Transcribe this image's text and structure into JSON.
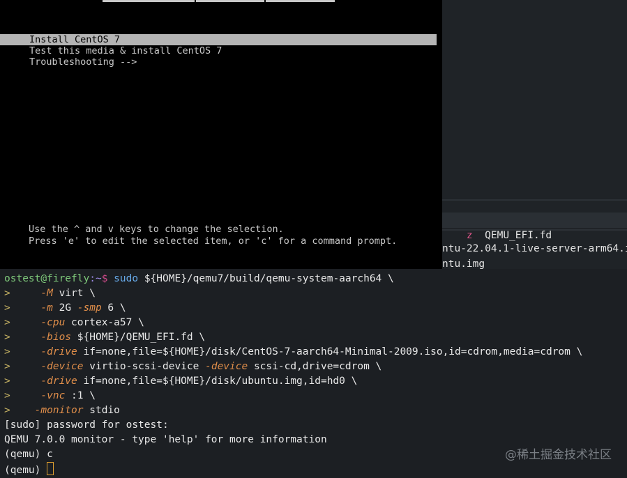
{
  "vnc": {
    "menu": [
      {
        "label": "Install CentOS 7",
        "selected": true
      },
      {
        "label": "Test this media & install CentOS 7",
        "selected": false
      },
      {
        "label": "Troubleshooting -->",
        "selected": false
      }
    ],
    "help_line1": "Use the ^ and v keys to change the selection.",
    "help_line2": "Press 'e' to edit the selected item, or 'c' for a command prompt."
  },
  "background_terminal": {
    "items": [
      {
        "marker": "z",
        "name": "QEMU_EFI.fd"
      },
      {
        "marker": "",
        "name": "ntu-22.04.1-live-server-arm64.i"
      },
      {
        "marker": "",
        "name": "ntu.img"
      }
    ]
  },
  "terminal": {
    "user_host": "ostest@firefly",
    "path": ":~",
    "dollar": "$",
    "cmd_sudo": "sudo",
    "cmd_binary_prefix": "${",
    "cmd_home": "HOME",
    "cmd_binary_rest": "}/qemu7/build/qemu-system-aarch64 \\",
    "continuation": ">",
    "args": [
      {
        "opt": "-M",
        "value": " virt \\"
      },
      {
        "opt": "-m",
        "value": " 2G ",
        "opt2": "-smp",
        "value2": " 6 \\"
      },
      {
        "opt": "-cpu",
        "value": " cortex-a57 \\"
      },
      {
        "opt": "-bios",
        "value": " ${HOME}/QEMU_EFI.fd \\"
      },
      {
        "opt": "-drive",
        "value": " if=none,file=${HOME}/disk/CentOS-7-aarch64-Minimal-2009.iso,id=cdrom,media=cdrom \\"
      },
      {
        "opt": "-device",
        "value": " virtio-scsi-device ",
        "opt2": "-device",
        "value2": " scsi-cd,drive=cdrom \\"
      },
      {
        "opt": "-drive",
        "value": " if=none,file=${HOME}/disk/ubuntu.img,id=hd0 \\"
      },
      {
        "opt": "-vnc",
        "value": " :1 \\"
      },
      {
        "opt": "-monitor",
        "value": " stdio"
      }
    ],
    "sudo_prompt": "[sudo] password for ostest:",
    "qemu_banner": "QEMU 7.0.0 monitor - type 'help' for more information",
    "qemu_prompt": "(qemu)",
    "qemu_cmd": "c",
    "qemu_prompt2": "(qemu)"
  },
  "watermark": "@稀土掘金技术社区"
}
